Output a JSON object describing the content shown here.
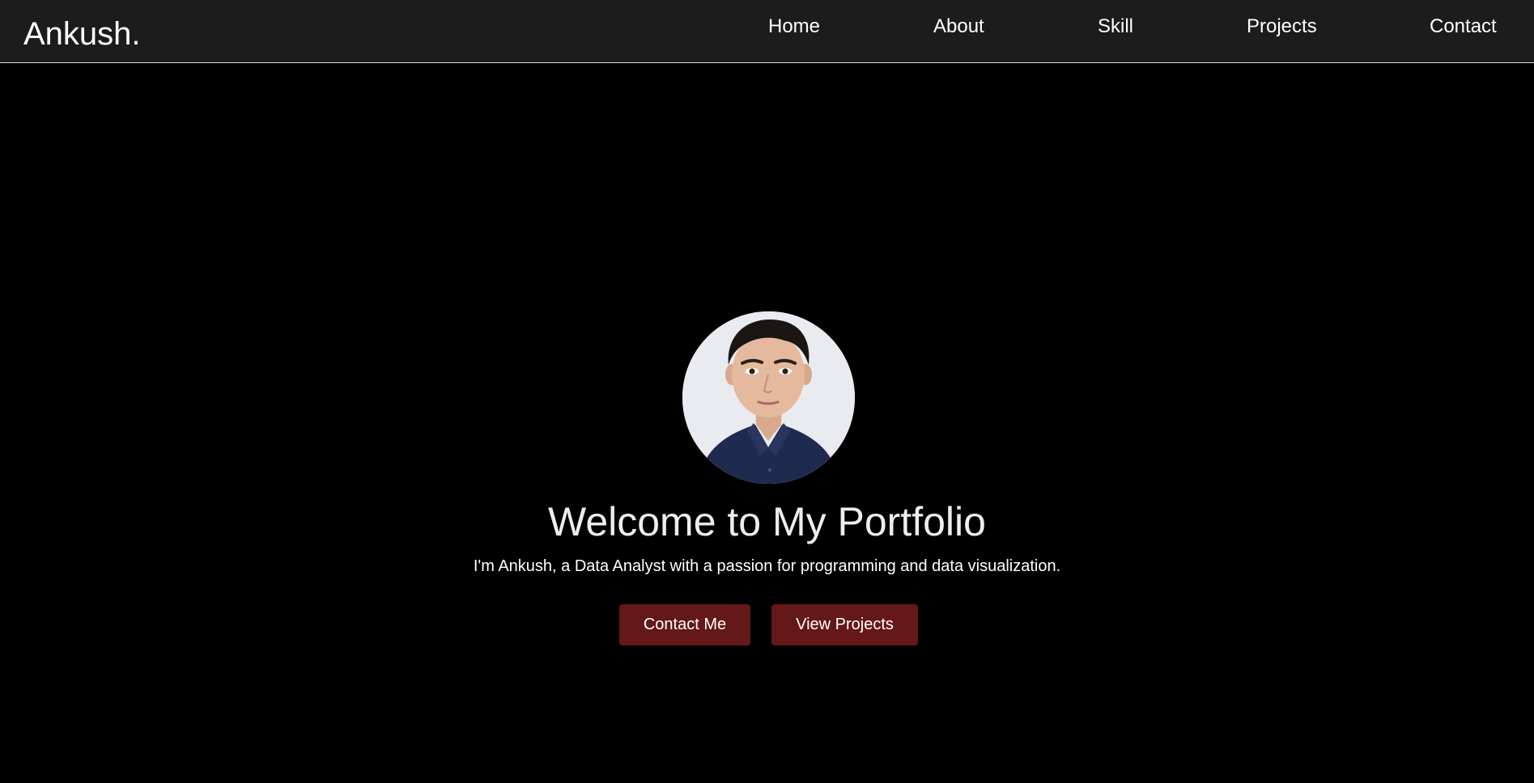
{
  "navbar": {
    "brand": "Ankush.",
    "links": [
      {
        "label": "Home"
      },
      {
        "label": "About"
      },
      {
        "label": "Skill"
      },
      {
        "label": "Projects"
      },
      {
        "label": "Contact"
      }
    ]
  },
  "hero": {
    "avatar_icon": "profile-photo",
    "title": "Welcome to My Portfolio",
    "subtitle": "I'm Ankush, a Data Analyst with a passion for programming and data visualization.",
    "buttons": {
      "contact_label": "Contact Me",
      "projects_label": "View Projects"
    }
  },
  "colors": {
    "page_background": "#000000",
    "navbar_background": "#1c1c1c",
    "button_background": "#641818",
    "text": "#ffffff"
  }
}
